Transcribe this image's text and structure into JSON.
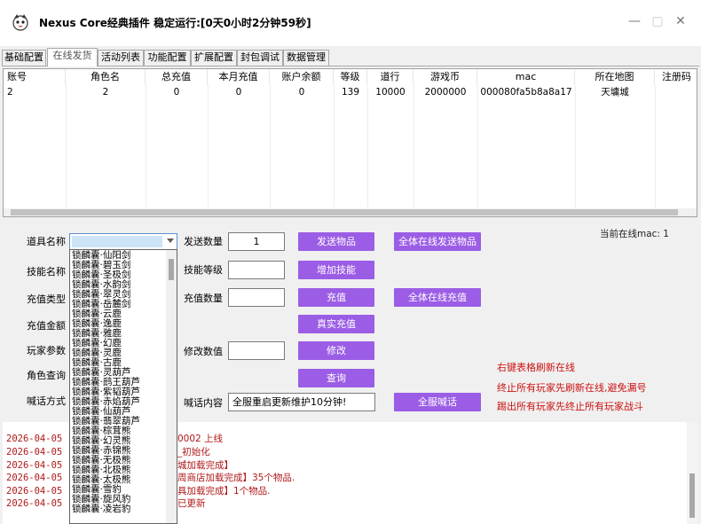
{
  "window": {
    "title": "Nexus Core经典插件  稳定运行:[0天0小时2分钟59秒]",
    "minimize_glyph": "—",
    "maximize_glyph": "▢",
    "close_glyph": "✕"
  },
  "tabs": [
    {
      "label": "基础配置"
    },
    {
      "label": "在线发货"
    },
    {
      "label": "活动列表"
    },
    {
      "label": "功能配置"
    },
    {
      "label": "扩展配置"
    },
    {
      "label": "封包调试"
    },
    {
      "label": "数据管理"
    }
  ],
  "grid": {
    "columns": [
      "账号",
      "角色名",
      "总充值",
      "本月充值",
      "账户余额",
      "等级",
      "道行",
      "游戏币",
      "mac",
      "所在地图",
      "注册码"
    ],
    "rows": [
      [
        "2",
        "2",
        "0",
        "0",
        "0",
        "139",
        "10000",
        "2000000",
        "000080fa5b8a8a17",
        "天墉城",
        ""
      ]
    ]
  },
  "form": {
    "item_name_label": "道具名称",
    "skill_name_label": "技能名称",
    "recharge_type_label": "充值类型",
    "recharge_amount_label": "充值金额",
    "player_param_label": "玩家参数",
    "role_query_label": "角色查询",
    "shout_mode_label": "喊话方式",
    "send_qty_label": "发送数量",
    "send_qty_value": "1",
    "skill_level_label": "技能等级",
    "recharge_qty_label": "充值数量",
    "modify_value_label": "修改数值",
    "shout_content_label": "喊话内容",
    "shout_content_value": "全服重启更新维护10分钟!"
  },
  "buttons": {
    "send_item": "发送物品",
    "send_all_online": "全体在线发送物品",
    "add_skill": "增加技能",
    "recharge": "充值",
    "recharge_all_online": "全体在线充值",
    "real_recharge": "真实充值",
    "modify": "修改",
    "query": "查询",
    "broadcast": "全服喊话"
  },
  "online_mac": "当前在线mac: 1",
  "hints": [
    "右键表格刷新在线",
    "终止所有玩家先刷新在线,避免漏号",
    "踢出所有玩家先终止所有玩家战斗"
  ],
  "dropdown_items": [
    "锁麟囊·仙阳剑",
    "锁麟囊·碧玉剑",
    "锁麟囊·圣极剑",
    "锁麟囊·水韵剑",
    "锁麟囊·翠灵剑",
    "锁麟囊·岳麓剑",
    "锁麟囊·云鹿",
    "锁麟囊·逸鹿",
    "锁麟囊·雅鹿",
    "锁麟囊·幻鹿",
    "锁麟囊·灵鹿",
    "锁麟囊·古鹿",
    "锁麟囊·灵葫芦",
    "锁麟囊·鸱王葫芦",
    "锁麟囊·紫韬葫芦",
    "锁麟囊·赤焰葫芦",
    "锁麟囊·仙葫芦",
    "锁麟囊·翡翠葫芦",
    "锁麟囊·棕茸熊",
    "锁麟囊·幻灵熊",
    "锁麟囊·赤锦熊",
    "锁麟囊·无极熊",
    "锁麟囊·北极熊",
    "锁麟囊·太极熊",
    "锁麟囊·雪豹",
    "锁麟囊·旋风豹",
    "锁麟囊·凌岩豹"
  ],
  "log": [
    {
      "time": "2026-04-05 16",
      "msg": "0002   上线"
    },
    {
      "time": "2026-04-05 16",
      "msg": "_初始化"
    },
    {
      "time": "2026-04-05 16",
      "msg": "城加载完成】"
    },
    {
      "time": "2026-04-05 16",
      "msg": "周商店加载完成】35个物品."
    },
    {
      "time": "2026-04-05 16",
      "msg": "具加载完成】1个物品."
    },
    {
      "time": "2026-04-05 16",
      "msg": "已更新"
    }
  ],
  "colors": {
    "button_purple": "#9b5de5",
    "hint_red": "#cc1111",
    "log_red": "#b01818"
  }
}
